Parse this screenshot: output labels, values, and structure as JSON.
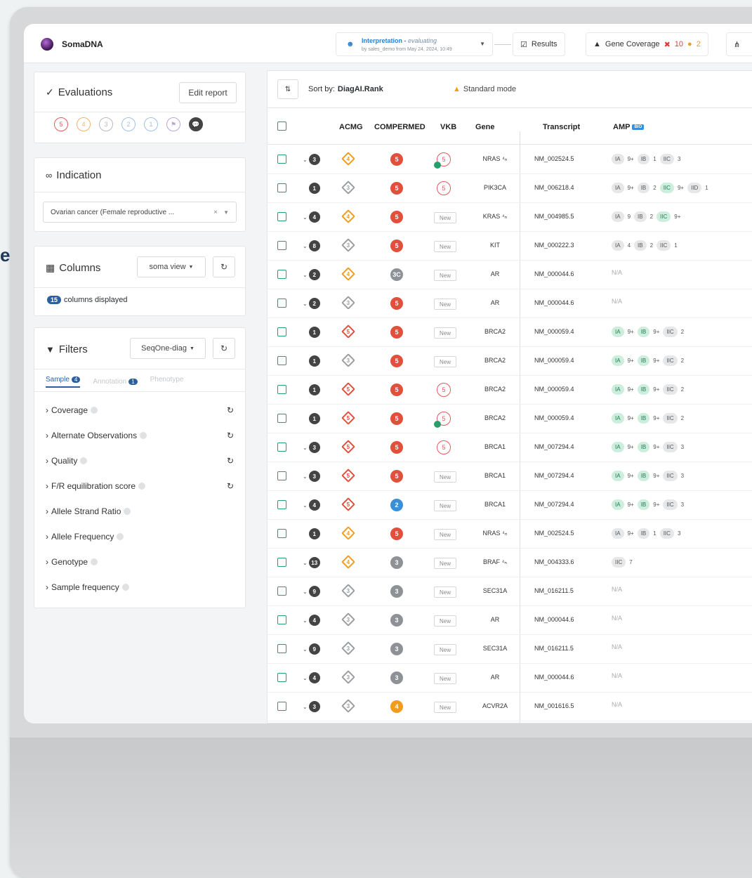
{
  "decor_text": "e",
  "app": {
    "name": "SomaDNA"
  },
  "interpretation": {
    "title": "Interpretation",
    "status": "evaluating",
    "subtitle": "by sales_demo from May 24, 2024, 10:49"
  },
  "tabs": {
    "results": "Results",
    "gene_coverage": "Gene Coverage",
    "gene_coverage_red": "10",
    "gene_coverage_orange": "2"
  },
  "evaluations": {
    "title": "Evaluations",
    "edit_button": "Edit report",
    "circles": [
      "5",
      "4",
      "3",
      "2",
      "1",
      "⚑",
      "💬"
    ]
  },
  "indication": {
    "title": "Indication",
    "value": "Ovarian cancer (Female reproductive ..."
  },
  "columns": {
    "title": "Columns",
    "view_select": "soma view",
    "count": "15",
    "count_label": "columns displayed"
  },
  "filters": {
    "title": "Filters",
    "preset_select": "SeqOne-diag",
    "tabs": [
      {
        "label": "Sample",
        "count": "4"
      },
      {
        "label": "Annotation",
        "count": "1"
      },
      {
        "label": "Phenotype",
        "count": ""
      }
    ],
    "items": [
      {
        "label": "Coverage",
        "reset": true
      },
      {
        "label": "Alternate Observations",
        "reset": true
      },
      {
        "label": "Quality",
        "reset": true
      },
      {
        "label": "F/R equilibration score",
        "reset": true
      },
      {
        "label": "Allele Strand Ratio",
        "reset": false
      },
      {
        "label": "Allele Frequency",
        "reset": false
      },
      {
        "label": "Genotype",
        "reset": false
      },
      {
        "label": "Sample frequency",
        "reset": false
      }
    ]
  },
  "table": {
    "sort_label": "Sort by:",
    "sort_value": "DiagAI.Rank",
    "mode": "Standard mode",
    "headers": {
      "acmg": "ACMG",
      "compermed": "COMPERMED",
      "vkb": "VKB",
      "gene": "Gene",
      "transcript": "Transcript",
      "amp": "AMP",
      "amp_badge": "BIO"
    },
    "colors": {
      "acmg_orange": "#f19c1e",
      "acmg_red": "#e0503c",
      "acmg_grey": "#9a9ea2",
      "cp_red": "#e0503c",
      "cp_grey": "#8e9296",
      "cp_blue": "#3a8fd6",
      "cp_orange": "#f19c1e"
    },
    "rows": [
      {
        "chev": true,
        "rank": "3",
        "acmg": "4",
        "acmg_c": "orange",
        "cp": "5",
        "cp_c": "red",
        "vkb": "5",
        "vkb_check": true,
        "gene": "NRAS ⁴ₙ",
        "tx": "NM_002524.5",
        "amp": [
          [
            "IA",
            "n"
          ],
          [
            "9+",
            "p"
          ],
          [
            "IB",
            "n"
          ],
          [
            "1",
            "p"
          ],
          [
            "IIC",
            "n"
          ],
          [
            "3",
            "p"
          ]
        ]
      },
      {
        "chev": false,
        "rank": "1",
        "acmg": "3",
        "acmg_c": "grey",
        "cp": "5",
        "cp_c": "red",
        "vkb": "5",
        "vkb_check": false,
        "gene": "PIK3CA",
        "tx": "NM_006218.4",
        "amp": [
          [
            "IA",
            "n"
          ],
          [
            "9+",
            "p"
          ],
          [
            "IB",
            "n"
          ],
          [
            "2",
            "p"
          ],
          [
            "IIC",
            "g"
          ],
          [
            "9+",
            "p"
          ],
          [
            "IID",
            "n"
          ],
          [
            "1",
            "p"
          ]
        ]
      },
      {
        "chev": true,
        "rank": "4",
        "acmg": "4",
        "acmg_c": "orange",
        "cp": "5",
        "cp_c": "red",
        "vkb": "New",
        "gene": "KRAS ⁴ₙ",
        "tx": "NM_004985.5",
        "amp": [
          [
            "IA",
            "n"
          ],
          [
            "9",
            "p"
          ],
          [
            "IB",
            "n"
          ],
          [
            "2",
            "p"
          ],
          [
            "IIC",
            "g"
          ],
          [
            "9+",
            "p"
          ]
        ]
      },
      {
        "chev": true,
        "rank": "8",
        "acmg": "3",
        "acmg_c": "grey",
        "cp": "5",
        "cp_c": "red",
        "vkb": "New",
        "gene": "KIT",
        "tx": "NM_000222.3",
        "amp": [
          [
            "IA",
            "n"
          ],
          [
            "4",
            "p"
          ],
          [
            "IB",
            "n"
          ],
          [
            "2",
            "p"
          ],
          [
            "IIC",
            "n"
          ],
          [
            "1",
            "p"
          ]
        ]
      },
      {
        "chev": true,
        "rank": "2",
        "acmg": "4",
        "acmg_c": "orange",
        "cp": "3C",
        "cp_c": "grey",
        "vkb": "New",
        "gene": "AR",
        "tx": "NM_000044.6",
        "amp": []
      },
      {
        "chev": true,
        "rank": "2",
        "acmg": "3",
        "acmg_c": "grey",
        "cp": "5",
        "cp_c": "red",
        "vkb": "New",
        "gene": "AR",
        "tx": "NM_000044.6",
        "amp": []
      },
      {
        "chev": false,
        "rank": "1",
        "acmg": "5",
        "acmg_c": "red",
        "cp": "5",
        "cp_c": "red",
        "vkb": "New",
        "gene": "BRCA2",
        "tx": "NM_000059.4",
        "amp": [
          [
            "IA",
            "g"
          ],
          [
            "9+",
            "p"
          ],
          [
            "IB",
            "g"
          ],
          [
            "9+",
            "p"
          ],
          [
            "IIC",
            "n"
          ],
          [
            "2",
            "p"
          ]
        ]
      },
      {
        "chev": false,
        "rank": "1",
        "acmg": "3",
        "acmg_c": "grey",
        "cp": "5",
        "cp_c": "red",
        "vkb": "New",
        "gene": "BRCA2",
        "tx": "NM_000059.4",
        "amp": [
          [
            "IA",
            "g"
          ],
          [
            "9+",
            "p"
          ],
          [
            "IB",
            "g"
          ],
          [
            "9+",
            "p"
          ],
          [
            "IIC",
            "n"
          ],
          [
            "2",
            "p"
          ]
        ]
      },
      {
        "chev": false,
        "rank": "1",
        "acmg": "5",
        "acmg_c": "red",
        "cp": "5",
        "cp_c": "red",
        "vkb": "5",
        "vkb_check": false,
        "gene": "BRCA2",
        "tx": "NM_000059.4",
        "amp": [
          [
            "IA",
            "g"
          ],
          [
            "9+",
            "p"
          ],
          [
            "IB",
            "g"
          ],
          [
            "9+",
            "p"
          ],
          [
            "IIC",
            "n"
          ],
          [
            "2",
            "p"
          ]
        ]
      },
      {
        "chev": false,
        "rank": "1",
        "acmg": "5",
        "acmg_c": "red",
        "cp": "5",
        "cp_c": "red",
        "vkb": "5",
        "vkb_check": true,
        "gene": "BRCA2",
        "tx": "NM_000059.4",
        "amp": [
          [
            "IA",
            "g"
          ],
          [
            "9+",
            "p"
          ],
          [
            "IB",
            "g"
          ],
          [
            "9+",
            "p"
          ],
          [
            "IIC",
            "n"
          ],
          [
            "2",
            "p"
          ]
        ]
      },
      {
        "chev": true,
        "rank": "3",
        "acmg": "5",
        "acmg_c": "red",
        "cp": "5",
        "cp_c": "red",
        "vkb": "5",
        "vkb_check": false,
        "gene": "BRCA1",
        "tx": "NM_007294.4",
        "amp": [
          [
            "IA",
            "g"
          ],
          [
            "9+",
            "p"
          ],
          [
            "IB",
            "g"
          ],
          [
            "9+",
            "p"
          ],
          [
            "IIC",
            "n"
          ],
          [
            "3",
            "p"
          ]
        ]
      },
      {
        "chev": true,
        "rank": "3",
        "acmg": "5",
        "acmg_c": "red",
        "cp": "5",
        "cp_c": "red",
        "vkb": "New",
        "gene": "BRCA1",
        "tx": "NM_007294.4",
        "amp": [
          [
            "IA",
            "g"
          ],
          [
            "9+",
            "p"
          ],
          [
            "IB",
            "g"
          ],
          [
            "9+",
            "p"
          ],
          [
            "IIC",
            "n"
          ],
          [
            "3",
            "p"
          ]
        ]
      },
      {
        "chev": true,
        "rank": "4",
        "acmg": "5",
        "acmg_c": "red",
        "cp": "2",
        "cp_c": "blue",
        "vkb": "New",
        "gene": "BRCA1",
        "tx": "NM_007294.4",
        "amp": [
          [
            "IA",
            "g"
          ],
          [
            "9+",
            "p"
          ],
          [
            "IB",
            "g"
          ],
          [
            "9+",
            "p"
          ],
          [
            "IIC",
            "n"
          ],
          [
            "3",
            "p"
          ]
        ]
      },
      {
        "chev": false,
        "rank": "1",
        "acmg": "4",
        "acmg_c": "orange",
        "cp": "5",
        "cp_c": "red",
        "vkb": "New",
        "gene": "NRAS ⁴ₙ",
        "tx": "NM_002524.5",
        "amp": [
          [
            "IA",
            "n"
          ],
          [
            "9+",
            "p"
          ],
          [
            "IB",
            "n"
          ],
          [
            "1",
            "p"
          ],
          [
            "IIC",
            "n"
          ],
          [
            "3",
            "p"
          ]
        ]
      },
      {
        "chev": true,
        "rank": "13",
        "acmg": "4",
        "acmg_c": "orange",
        "cp": "3",
        "cp_c": "grey",
        "vkb": "New",
        "gene": "BRAF ⁴ₙ",
        "tx": "NM_004333.6",
        "amp": [
          [
            "IIC",
            "n"
          ],
          [
            "7",
            "p"
          ]
        ]
      },
      {
        "chev": true,
        "rank": "9",
        "acmg": "3",
        "acmg_c": "grey",
        "cp": "3",
        "cp_c": "grey",
        "vkb": "New",
        "gene": "SEC31A",
        "tx": "NM_016211.5",
        "amp": []
      },
      {
        "chev": true,
        "rank": "4",
        "acmg": "3",
        "acmg_c": "grey",
        "cp": "3",
        "cp_c": "grey",
        "vkb": "New",
        "gene": "AR",
        "tx": "NM_000044.6",
        "amp": []
      },
      {
        "chev": true,
        "rank": "9",
        "acmg": "3",
        "acmg_c": "grey",
        "cp": "3",
        "cp_c": "grey",
        "vkb": "New",
        "gene": "SEC31A",
        "tx": "NM_016211.5",
        "amp": []
      },
      {
        "chev": true,
        "rank": "4",
        "acmg": "3",
        "acmg_c": "grey",
        "cp": "3",
        "cp_c": "grey",
        "vkb": "New",
        "gene": "AR",
        "tx": "NM_000044.6",
        "amp": []
      },
      {
        "chev": true,
        "rank": "3",
        "acmg": "3",
        "acmg_c": "grey",
        "cp": "4",
        "cp_c": "orange",
        "vkb": "New",
        "gene": "ACVR2A",
        "tx": "NM_001616.5",
        "amp": []
      }
    ],
    "na_text": "N/A"
  }
}
